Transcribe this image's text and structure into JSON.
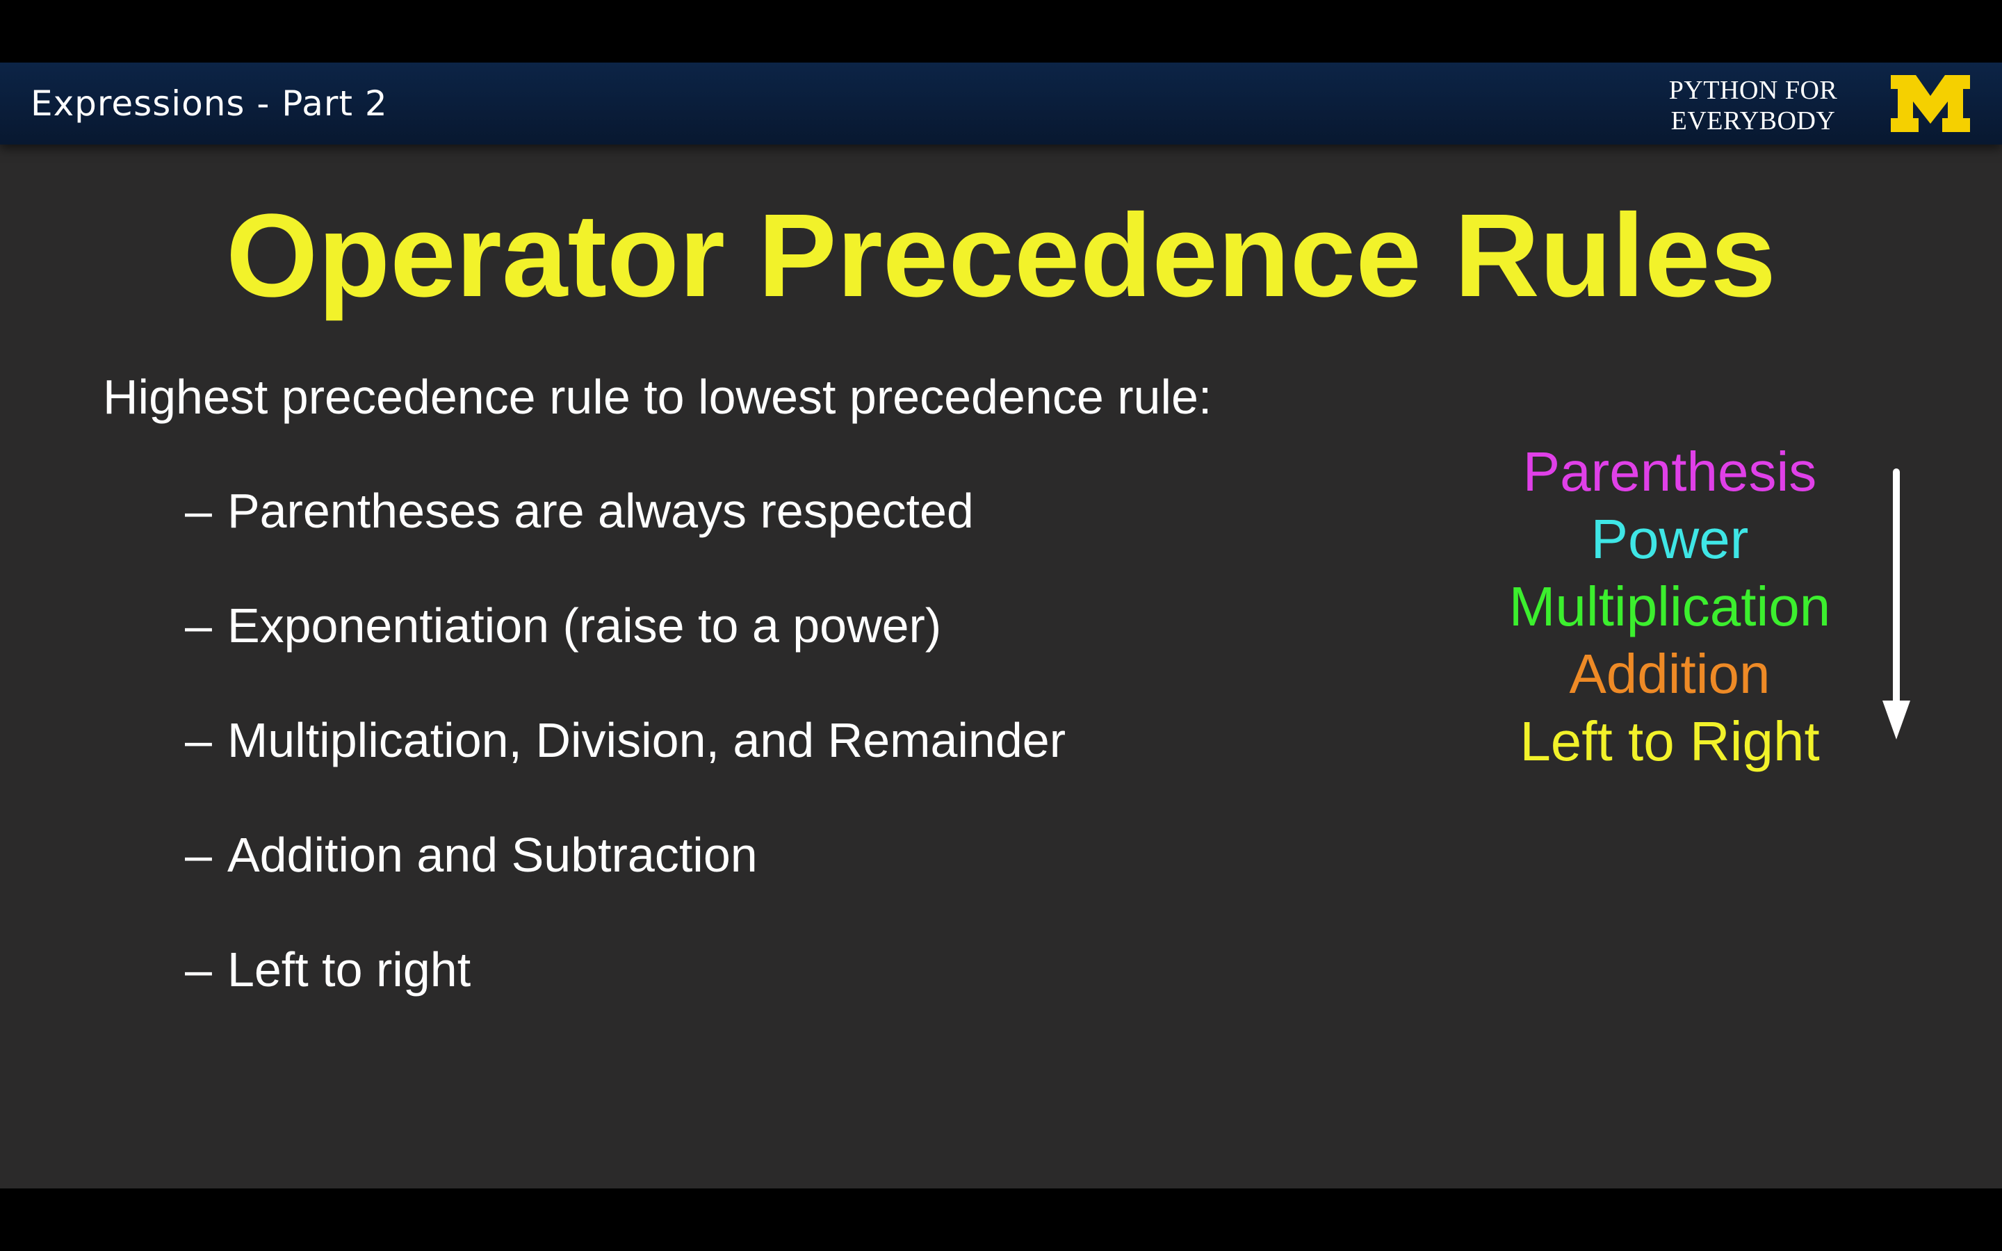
{
  "header": {
    "lecture_title": "Expressions - Part 2",
    "brand_line1": "PYTHON FOR",
    "brand_line2": "EVERYBODY",
    "logo_icon": "michigan-block-m-logo",
    "logo_color": "#f5d000"
  },
  "slide": {
    "title": "Operator Precedence Rules",
    "title_color": "#f2f22a",
    "intro": "Highest precedence rule to lowest precedence rule:",
    "dash": "–",
    "rules": [
      {
        "text": "Parentheses are always respected"
      },
      {
        "text": "Exponentiation (raise to a power)"
      },
      {
        "text": "Multiplication, Division, and Remainder"
      },
      {
        "text": "Addition and Subtraction"
      },
      {
        "text": "Left to right"
      }
    ],
    "mnemonic": [
      {
        "text": "Parenthesis",
        "color": "#e040e8"
      },
      {
        "text": "Power",
        "color": "#3fe6e6"
      },
      {
        "text": "Multiplication",
        "color": "#3cef2e"
      },
      {
        "text": "Addition",
        "color": "#ee8a26"
      },
      {
        "text": "Left to Right",
        "color": "#f2f22a"
      }
    ],
    "arrow_icon": "down-arrow-icon"
  }
}
